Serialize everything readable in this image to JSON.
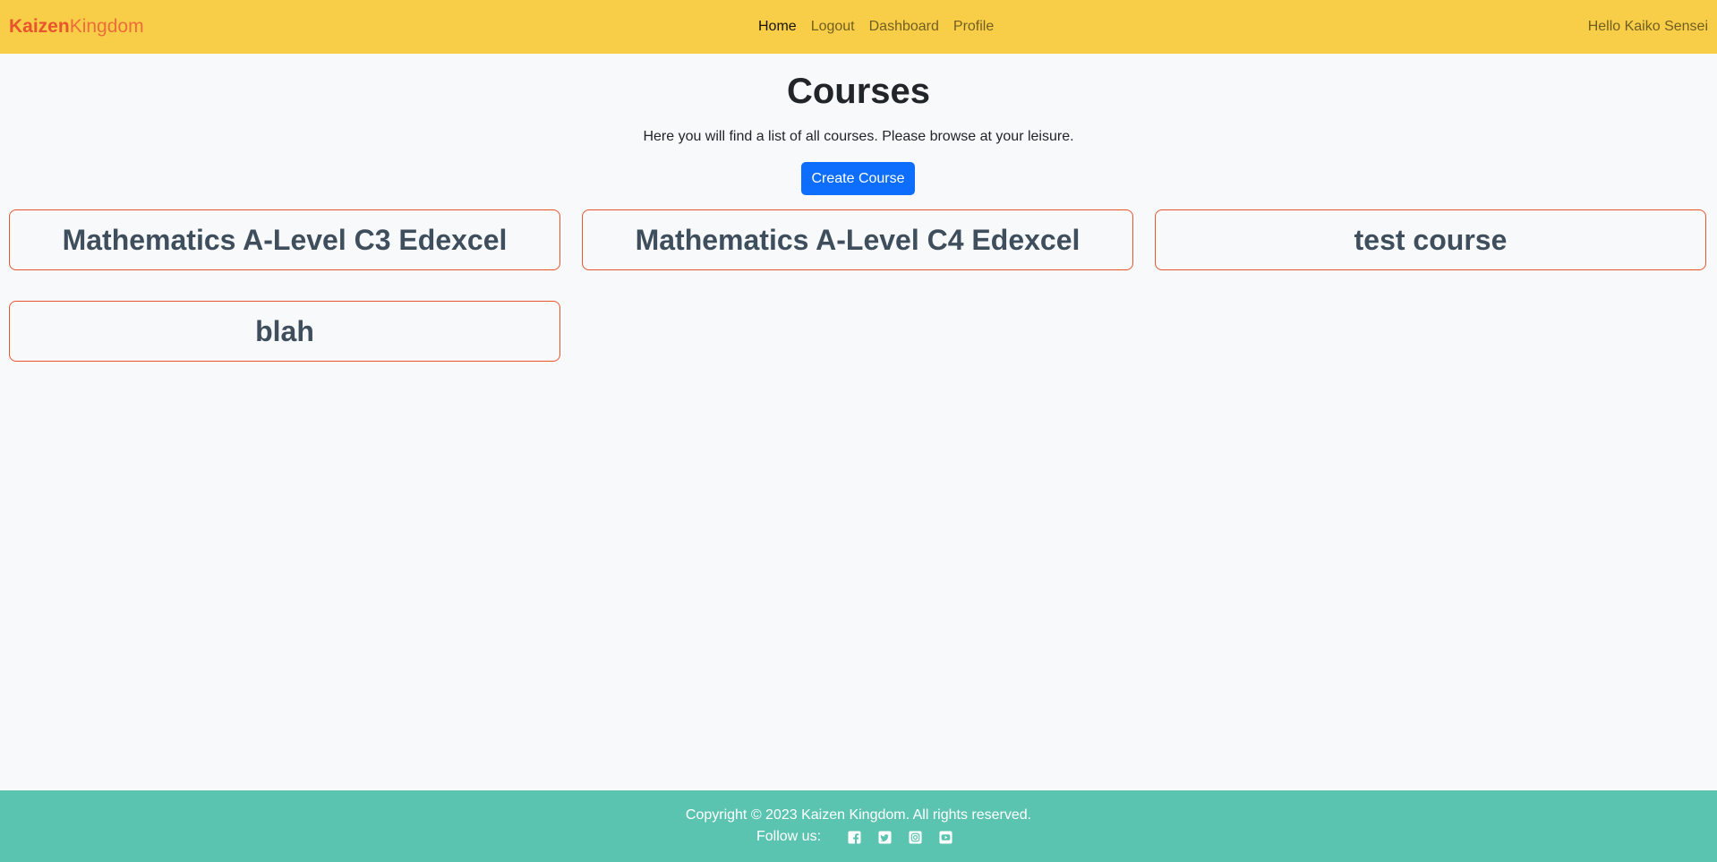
{
  "navbar": {
    "brand_part1": "Kaizen",
    "brand_part2": "Kingdom",
    "links": [
      {
        "label": "Home"
      },
      {
        "label": "Logout"
      },
      {
        "label": "Dashboard"
      },
      {
        "label": "Profile"
      }
    ],
    "active_link": "Home",
    "greeting": "Hello Kaiko Sensei",
    "background_color": "#f8ce48",
    "brand_color": "#e8542c"
  },
  "main": {
    "title": "Courses",
    "intro": "Here you will find a list of all courses. Please browse at your leisure.",
    "create_button_label": "Create Course",
    "create_button_color": "#0d6efd",
    "courses": [
      {
        "title": "Mathematics A-Level C3 Edexcel"
      },
      {
        "title": "Mathematics A-Level C4 Edexcel"
      },
      {
        "title": "test course"
      },
      {
        "title": "blah"
      }
    ],
    "card_border_color": "#e8542c"
  },
  "footer": {
    "copyright": "Copyright © 2023 Kaizen Kingdom. All rights reserved.",
    "follow_label": "Follow us:",
    "social_icons": [
      "facebook-icon",
      "twitter-icon",
      "instagram-icon",
      "youtube-icon"
    ],
    "background_color": "#5bc4b0"
  }
}
